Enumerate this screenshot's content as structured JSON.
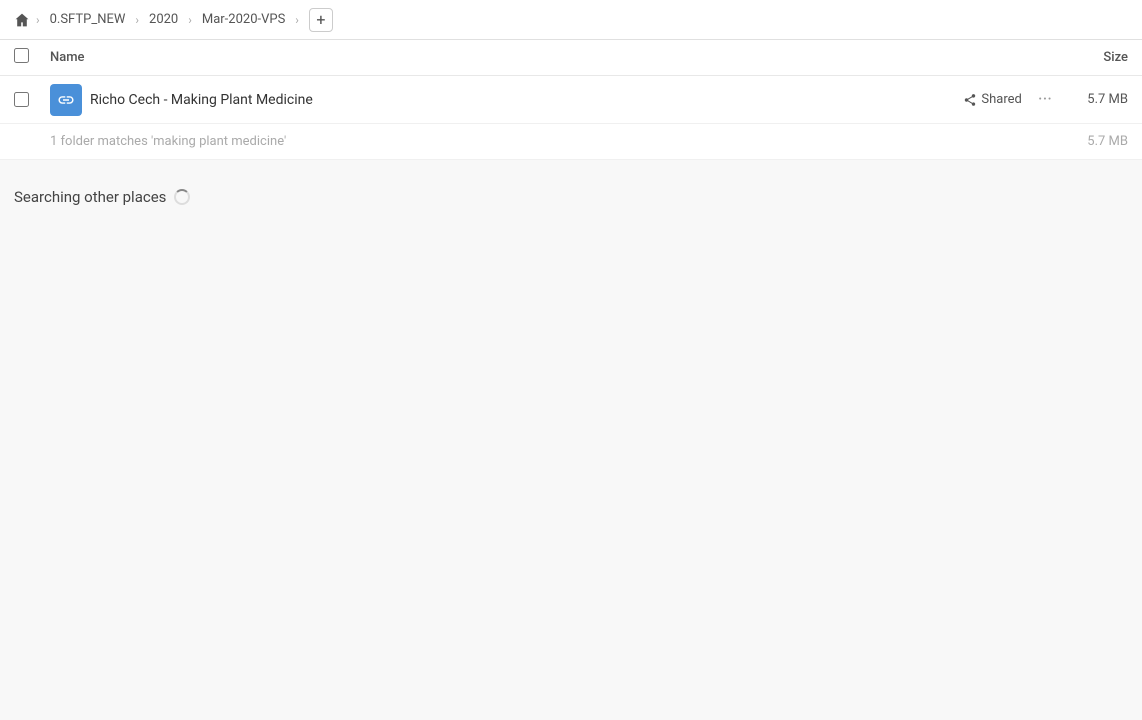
{
  "breadcrumb": {
    "home_icon": "home",
    "items": [
      {
        "label": "0.SFTP_NEW"
      },
      {
        "label": "2020"
      },
      {
        "label": "Mar-2020-VPS"
      }
    ],
    "add_label": "+"
  },
  "table": {
    "col_name_label": "Name",
    "col_size_label": "Size"
  },
  "file_row": {
    "name": "Richo Cech - Making Plant Medicine",
    "shared_label": "Shared",
    "more_label": "···",
    "size": "5.7 MB"
  },
  "summary": {
    "text": "1 folder matches 'making plant medicine'",
    "size": "5.7 MB"
  },
  "searching": {
    "label": "Searching other places"
  }
}
